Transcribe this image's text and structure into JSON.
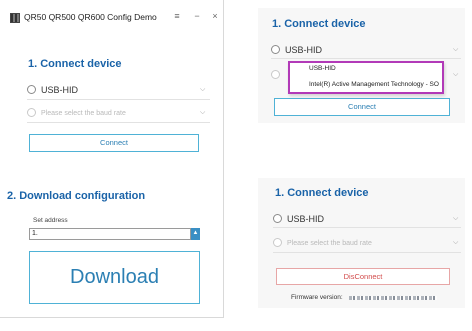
{
  "window": {
    "title": "QR50 QR500 QR600 Config Demo",
    "controls": {
      "pin": "≡",
      "minimize": "−",
      "close": "×"
    }
  },
  "main": {
    "connect_title": "1. Connect device",
    "interface_value": "USB-HID",
    "baud_placeholder": "Please select the baud rate",
    "connect_button": "Connect",
    "download_title": "2. Download configuration",
    "set_address_label": "Set address",
    "address_value": "1.",
    "download_button": "Download"
  },
  "panel_top": {
    "connect_title": "1. Connect device",
    "interface_value": "USB-HID",
    "dropdown_options": [
      "USB-HID",
      "Intel(R) Active Management Technology - SO"
    ],
    "connect_button": "Connect"
  },
  "panel_bottom": {
    "connect_title": "1. Connect device",
    "interface_value": "USB-HID",
    "baud_placeholder": "Please select the baud rate",
    "disconnect_button": "DisConnect",
    "firmware_label": "Firmware version:"
  },
  "icons": {
    "app": "app-logo-icon",
    "chevron": "chevron-down-icon",
    "radio": "radio-circle-icon",
    "spinner": "spinner-arrows-icon"
  },
  "colors": {
    "accent_title": "#1a63a8",
    "button_border": "#4fb2d6",
    "disconnect_text": "#d24b4b",
    "highlight_box": "#b23ab8"
  }
}
